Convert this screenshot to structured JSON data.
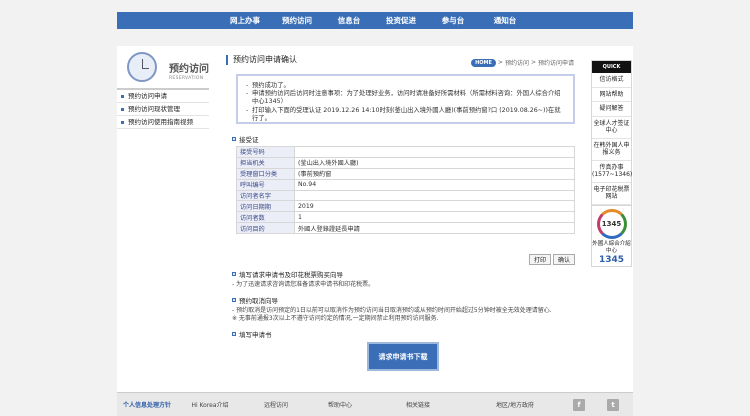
{
  "topnav": [
    "网上办事",
    "预约访问",
    "信息台",
    "投资促进",
    "参与台",
    "通知台"
  ],
  "sidebar": {
    "title": "预约访问",
    "subtitle": "RESERVATION",
    "items": [
      "预约访问申请",
      "预约访问现状管理",
      "预约访问使用指南视频"
    ]
  },
  "main": {
    "title": "预约访问申请确认",
    "breadcrumb": [
      "HOME",
      "预约访问",
      "预约访问申请"
    ]
  },
  "notice": [
    "预约成功了。",
    "申请预约访问后访问时注意事项：为了处理好业务，访问时请准备好所需材料（所需材料咨询：外国人综合介绍中心1345）",
    "打印输入下面的受理认证 2019.12.26 14:10时刻(釜山出入境外國人廳)(事前预约窗?口 (2019.08.26~))在就行了。"
  ],
  "receipt": {
    "section_title": "接受证",
    "rows": [
      {
        "k": "接受号码",
        "v": ""
      },
      {
        "k": "担当机关",
        "v": "(釜山出入境外國人廳)"
      },
      {
        "k": "受理窗口分类",
        "v": "(事前預約窗"
      },
      {
        "k": "呼叫编号",
        "v": "No.94"
      },
      {
        "k": "访问者名字",
        "v": ""
      },
      {
        "k": "访问日期期",
        "v": "2019"
      },
      {
        "k": "访问者数",
        "v": "1"
      },
      {
        "k": "访问目的",
        "v": "外國人登錄證延長申請"
      }
    ],
    "print_label": "打印",
    "confirm_label": "确认"
  },
  "guide": {
    "fill_title": "填写请求申请书及印花税票购买向导",
    "fill_text": "- 为了迅速请求咨询请您准备请求申请书和印花税票。",
    "cancel_title": "预约取消向导",
    "cancel_text1": "- 预约取消是访问预定的1日以前可以取消作为预约访问当日取消预约或从预约时间开始超过5分钟时被全无效处理请留心.",
    "cancel_text2": "※ 无事前通报3次以上不遵守访问约定的情况,一定期间禁止利用预约访问服务.",
    "form_title": "填写申请书",
    "download_label": "请求申请书下载"
  },
  "quick": {
    "header": "QUICK",
    "items": [
      "信访格式",
      "网站帮助",
      "疑问解答",
      "全球人才签证中心",
      "在韩外国人申报义务",
      "传真办事 (1577~1346)",
      "电子印花税票网站"
    ],
    "center_logo": "1345",
    "center_name": "外國人綜合介紹中心",
    "center_number": "1345"
  },
  "footer": [
    "个人信息处理方针",
    "Hi Korea介绍",
    "远程访问",
    "帮助中心",
    "相关链接",
    "地区/地方政府"
  ],
  "social": {
    "facebook": "f",
    "twitter": "t"
  },
  "colors": {
    "accent": "#3a6fb7",
    "header_bg": "#111111"
  }
}
